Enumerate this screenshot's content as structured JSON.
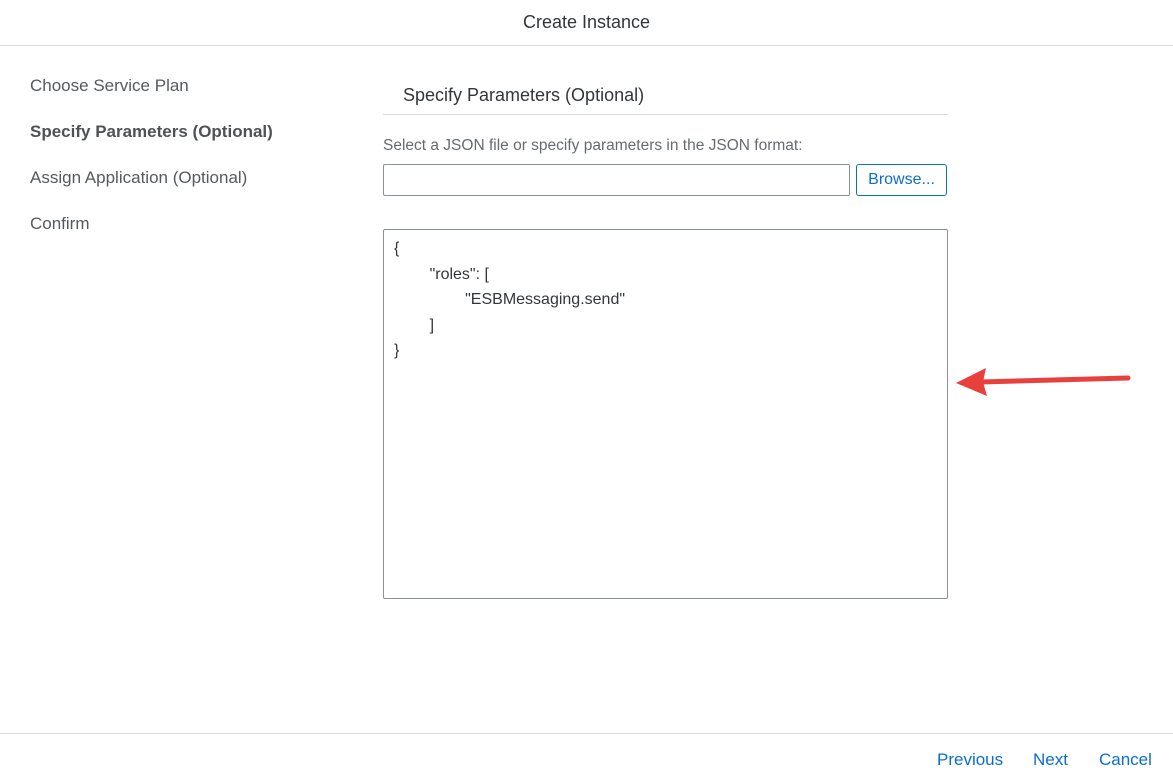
{
  "dialog": {
    "title": "Create Instance"
  },
  "steps": [
    {
      "label": "Choose Service Plan",
      "active": false
    },
    {
      "label": "Specify Parameters (Optional)",
      "active": true
    },
    {
      "label": "Assign Application (Optional)",
      "active": false
    },
    {
      "label": "Confirm",
      "active": false
    }
  ],
  "section": {
    "title": "Specify Parameters (Optional)",
    "field_label": "Select a JSON file or specify parameters in the JSON format:",
    "file_value": "",
    "browse_label": "Browse...",
    "json_value": "{\n        \"roles\": [\n                \"ESBMessaging.send\"\n        ]\n}"
  },
  "annotation": {
    "arrow_color": "#e8413d",
    "arrow_icon": "left-arrow-icon"
  },
  "footer": {
    "previous_label": "Previous",
    "next_label": "Next",
    "cancel_label": "Cancel"
  },
  "colors": {
    "accent": "#0a6ed1",
    "divider": "#d9d9d9"
  }
}
